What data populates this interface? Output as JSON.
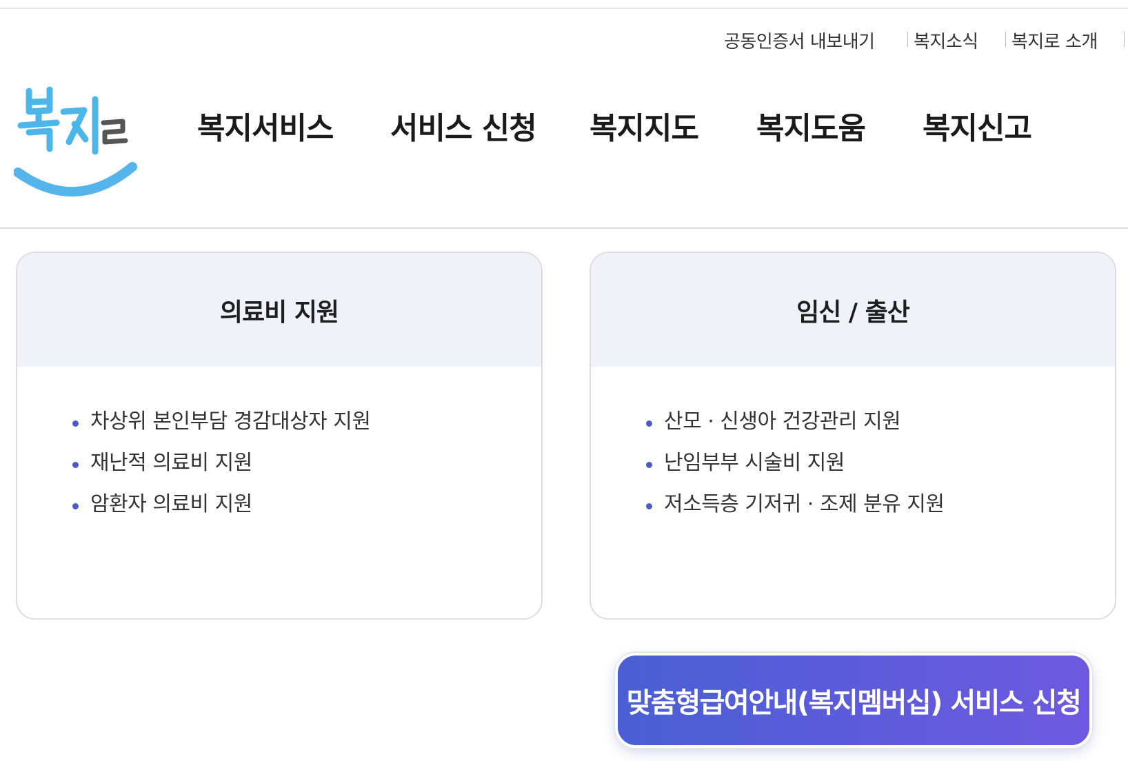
{
  "utility_links": [
    "공동인증서 내보내기",
    "복지소식",
    "복지로 소개"
  ],
  "logo": {
    "text": "복지로",
    "colors": {
      "letters": "#4db6e8",
      "smile": "#55b4ea"
    }
  },
  "nav": [
    "복지서비스",
    "서비스 신청",
    "복지지도",
    "복지도움",
    "복지신고"
  ],
  "cards": [
    {
      "title": "의료비 지원",
      "items": [
        "차상위 본인부담 경감대상자 지원",
        "재난적 의료비 지원",
        "암환자 의료비 지원"
      ]
    },
    {
      "title": "임신 / 출산",
      "items": [
        "산모 · 신생아 건강관리 지원",
        "난임부부 시술비 지원",
        "저소득층 기저귀 · 조제 분유 지원"
      ]
    }
  ],
  "cta": {
    "label": "맞춤형급여안내(복지멤버십) 서비스 신청"
  },
  "colors": {
    "accent": "#4a5bd1",
    "card_head_bg": "#f0f2f9",
    "cta_gradient_start": "#4a5fd3",
    "cta_gradient_end": "#6e59e0"
  }
}
